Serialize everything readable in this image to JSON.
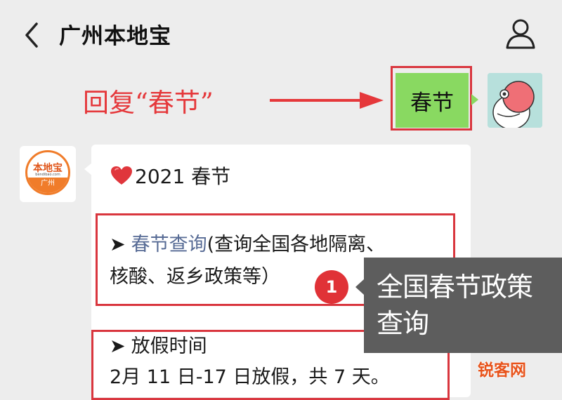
{
  "header": {
    "title": "广州本地宝",
    "back_icon": "chevron-left-icon",
    "profile_icon": "person-icon"
  },
  "instruction": {
    "text": "回复“春节”",
    "color": "#e5383b"
  },
  "sent_message": {
    "text": "春节",
    "bubble_color": "#89d961"
  },
  "bot": {
    "avatar_logo": "本地宝",
    "avatar_sub": "bendibao.com",
    "avatar_city": "广州"
  },
  "reply": {
    "heading_icon": "heart-icon",
    "heading": "2021 春节",
    "item1": {
      "marker": "➤",
      "link": "春节查询",
      "desc_line1": "(查询全国各地隔离、",
      "desc_line2": "核酸、返乡政策等）"
    },
    "item2": {
      "marker": "➤",
      "title": "放假时间",
      "detail": "2月 11 日-17 日放假，共 7 天。"
    }
  },
  "callout": {
    "badge": "1",
    "text_line1": "全国春节政策",
    "text_line2": "查询"
  },
  "watermark": "锐客网",
  "colors": {
    "highlight_border": "#d9363e",
    "link": "#576b95",
    "tooltip_bg": "#5d5d5d"
  }
}
